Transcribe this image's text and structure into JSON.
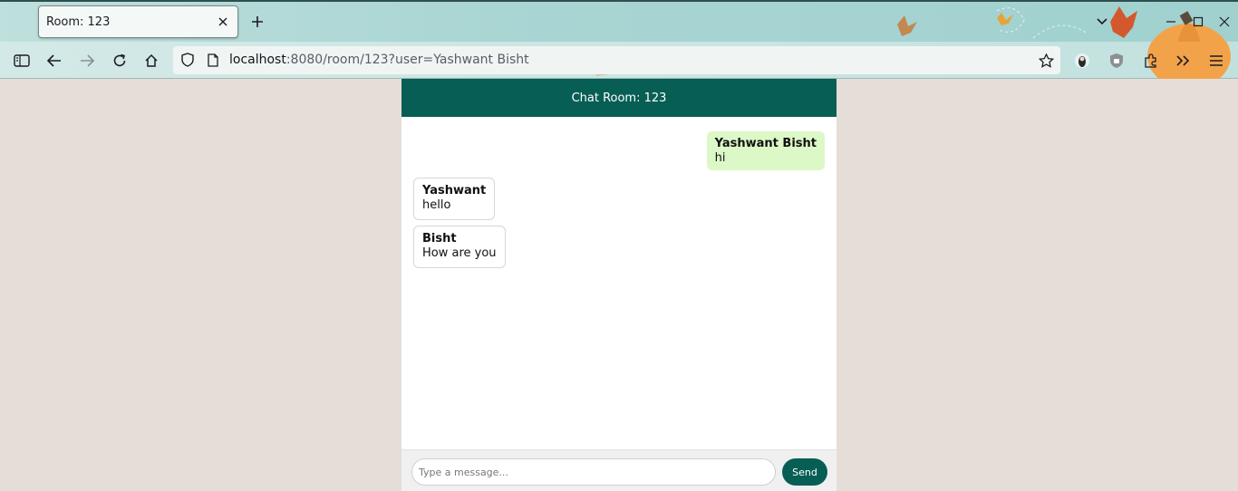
{
  "browser": {
    "tab_title": "Room: 123",
    "url_host": "localhost",
    "url_rest": ":8080/room/123?user=Yashwant Bisht",
    "theme_colors": {
      "tab_strip": "#a9d5d3",
      "toolbar": "#c9e5e2"
    }
  },
  "chat": {
    "header_title": "Chat Room: 123",
    "header_color": "#075e54",
    "messages": [
      {
        "sender": "Yashwant Bisht",
        "text": "hi",
        "own": true
      },
      {
        "sender": "Yashwant",
        "text": "hello",
        "own": false
      },
      {
        "sender": "Bisht",
        "text": "How are you",
        "own": false
      }
    ],
    "input_placeholder": "Type a message...",
    "send_label": "Send",
    "own_bubble_color": "#dcf8c6"
  },
  "page": {
    "background": "#e5ddd8"
  }
}
